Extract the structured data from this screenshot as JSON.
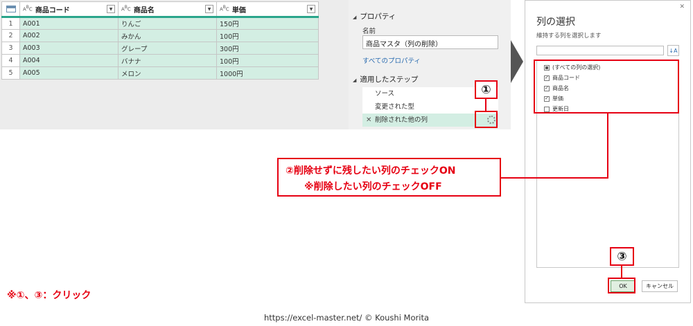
{
  "grid": {
    "columns": [
      {
        "type_icon": "ABC",
        "name": "商品コード"
      },
      {
        "type_icon": "ABC",
        "name": "商品名"
      },
      {
        "type_icon": "ABC",
        "name": "単価"
      }
    ],
    "rows": [
      {
        "num": "1",
        "code": "A001",
        "name": "りんご",
        "price": "150円"
      },
      {
        "num": "2",
        "code": "A002",
        "name": "みかん",
        "price": "100円"
      },
      {
        "num": "3",
        "code": "A003",
        "name": "グレープ",
        "price": "300円"
      },
      {
        "num": "4",
        "code": "A004",
        "name": "バナナ",
        "price": "100円"
      },
      {
        "num": "5",
        "code": "A005",
        "name": "メロン",
        "price": "1000円"
      }
    ]
  },
  "properties": {
    "heading": "プロパティ",
    "name_label": "名前",
    "name_value": "商品マスタ（列の削除）",
    "all_props_link": "すべてのプロパティ"
  },
  "steps": {
    "heading": "適用したステップ",
    "items": [
      "ソース",
      "変更された型",
      "削除された他の列"
    ]
  },
  "dialog": {
    "title": "列の選択",
    "subtitle": "維持する列を選択します",
    "items": [
      {
        "label": "(すべての列の選択)",
        "state": "partial"
      },
      {
        "label": "商品コード",
        "state": "checked"
      },
      {
        "label": "商品名",
        "state": "checked"
      },
      {
        "label": "単価",
        "state": "checked"
      },
      {
        "label": "更新日",
        "state": "unchecked"
      }
    ],
    "ok_label": "OK",
    "cancel_label": "キャンセル"
  },
  "annotations": {
    "badge1": "①",
    "badge3": "③",
    "callout_line1": "②削除せずに残したい列のチェックON",
    "callout_line2": "※削除したい列のチェックOFF",
    "note": "※①、③：クリック",
    "accent": "#e60012"
  },
  "footer": "https://excel-master.net/ © Koushi Morita"
}
